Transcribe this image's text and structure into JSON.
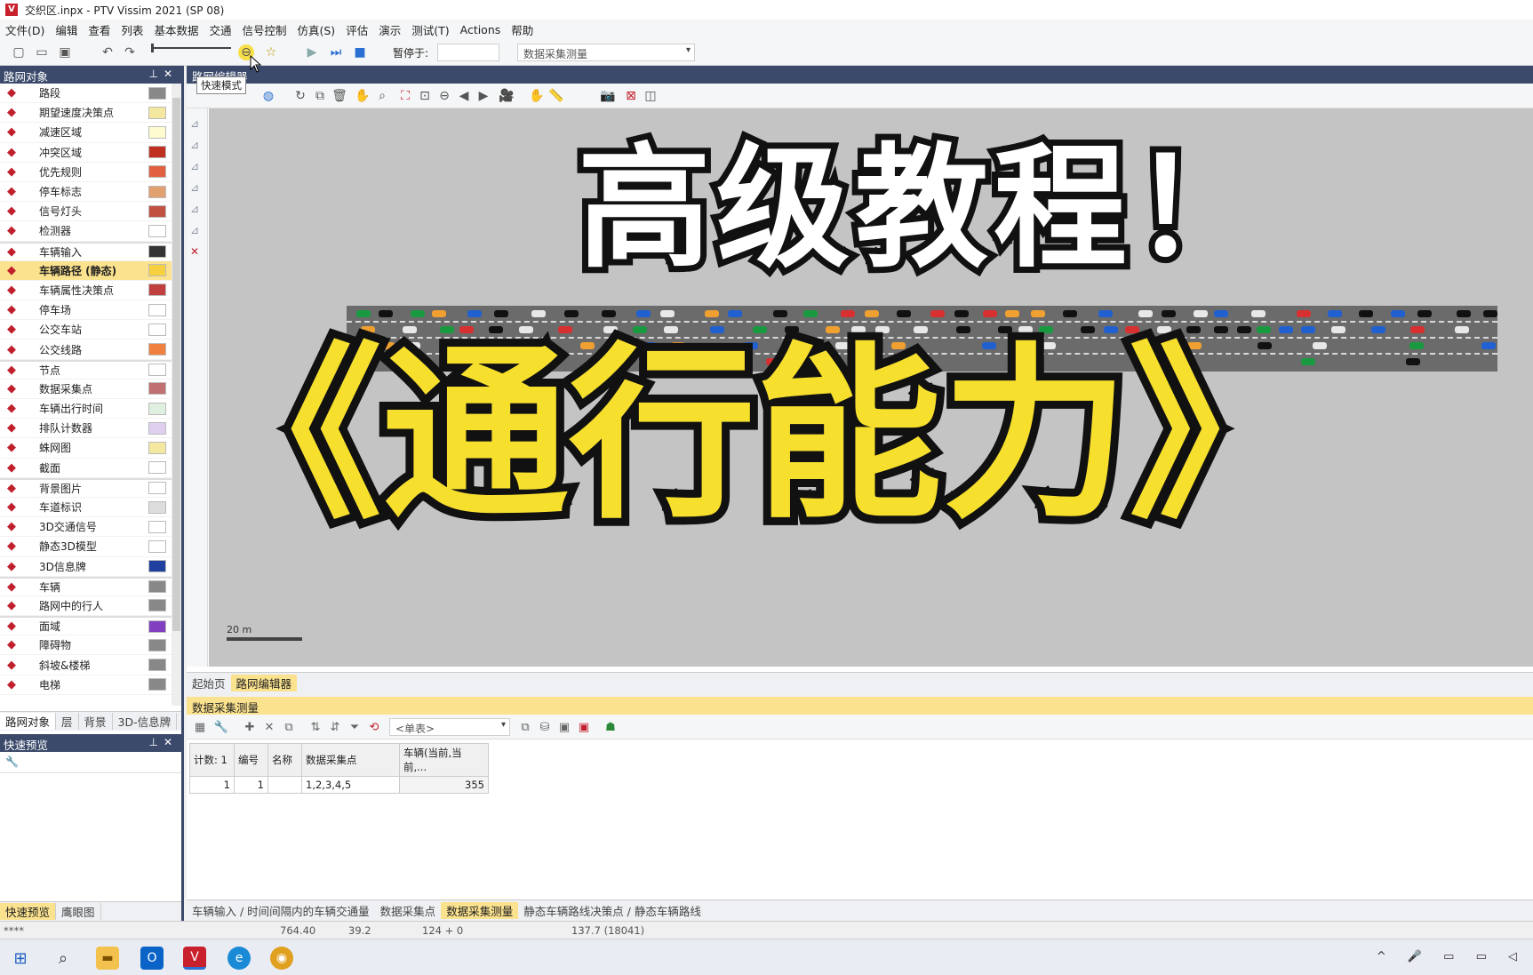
{
  "window": {
    "title": "交织区.inpx - PTV Vissim 2021 (SP 08)",
    "app_icon": "vissim-app-icon"
  },
  "menu": [
    "文件(D)",
    "编辑",
    "查看",
    "列表",
    "基本数据",
    "交通",
    "信号控制",
    "仿真(S)",
    "评估",
    "演示",
    "测试(T)",
    "Actions",
    "帮助"
  ],
  "toolbar": {
    "pause_label": "暂停于:",
    "pause_value": "",
    "view_select": "数据采集测量",
    "tooltip": "快速模式"
  },
  "network_objects": {
    "title": "路网对象",
    "items": [
      {
        "label": "路段",
        "icon": "link-icon",
        "swatch": "#888888"
      },
      {
        "label": "期望速度决策点",
        "icon": "speed-50-icon",
        "swatch": "#f4e7a0"
      },
      {
        "label": "减速区域",
        "icon": "warning-triangle-icon",
        "swatch": "#fffbd0"
      },
      {
        "label": "冲突区域",
        "icon": "conflict-area-icon",
        "swatch": "#c03020"
      },
      {
        "label": "优先规则",
        "icon": "yield-icon",
        "swatch": "#e06040"
      },
      {
        "label": "停车标志",
        "icon": "stop-sign-icon",
        "swatch": "#e0a070"
      },
      {
        "label": "信号灯头",
        "icon": "signal-head-icon",
        "swatch": "#c05040"
      },
      {
        "label": "检测器",
        "icon": "detector-icon",
        "swatch": "#ffffff"
      },
      {
        "label": "车辆输入",
        "icon": "vehicle-input-icon",
        "swatch": "#333333"
      },
      {
        "label": "车辆路径 (静态)",
        "icon": "static-route-icon",
        "swatch": "#f7d040",
        "selected": true
      },
      {
        "label": "车辆属性决策点",
        "icon": "vehicle-attr-icon",
        "swatch": "#c04040"
      },
      {
        "label": "停车场",
        "icon": "parking-icon",
        "swatch": "#ffffff"
      },
      {
        "label": "公交车站",
        "icon": "bus-stop-icon",
        "swatch": "#ffffff"
      },
      {
        "label": "公交线路",
        "icon": "bus-line-icon",
        "swatch": "#f08040"
      },
      {
        "label": "节点",
        "icon": "node-icon",
        "swatch": "#ffffff"
      },
      {
        "label": "数据采集点",
        "icon": "data-point-icon",
        "swatch": "#c07070"
      },
      {
        "label": "车辆出行时间",
        "icon": "travel-time-icon",
        "swatch": "#e0f0e0"
      },
      {
        "label": "排队计数器",
        "icon": "queue-counter-icon",
        "swatch": "#e0d0f0"
      },
      {
        "label": "蛛网图",
        "icon": "spider-icon",
        "swatch": "#f4e7a0"
      },
      {
        "label": "截面",
        "icon": "section-icon",
        "swatch": "#ffffff"
      },
      {
        "label": "背景图片",
        "icon": "background-image-icon",
        "swatch": "#ffffff"
      },
      {
        "label": "车道标识",
        "icon": "lane-marking-icon",
        "swatch": "#dddddd"
      },
      {
        "label": "3D交通信号",
        "icon": "3d-signal-icon",
        "swatch": "#ffffff"
      },
      {
        "label": "静态3D模型",
        "icon": "static-3d-icon",
        "swatch": "#ffffff"
      },
      {
        "label": "3D信息牌",
        "icon": "info-sign-icon",
        "swatch": "#2040a0"
      },
      {
        "label": "车辆",
        "icon": "vehicle-icon",
        "swatch": "#888888"
      },
      {
        "label": "路网中的行人",
        "icon": "pedestrian-icon",
        "swatch": "#888888"
      },
      {
        "label": "面域",
        "icon": "area-icon",
        "swatch": "#8040c0"
      },
      {
        "label": "障碍物",
        "icon": "obstacle-icon",
        "swatch": "#888888"
      },
      {
        "label": "斜坡&楼梯",
        "icon": "ramp-icon",
        "swatch": "#888888"
      },
      {
        "label": "电梯",
        "icon": "elevator-icon",
        "swatch": "#888888"
      }
    ],
    "tabs": [
      "路网对象",
      "层",
      "背景",
      "3D-信息牌"
    ]
  },
  "quick_view": {
    "title": "快速预览",
    "tabs": [
      "快速预览",
      "鹰眼图"
    ]
  },
  "editor": {
    "title": "路网编辑器",
    "scale_label": "20 m",
    "tabs": [
      "起始页",
      "路网编辑器"
    ],
    "overlay_line1": "高级教程！",
    "overlay_line2": "《通行能力》"
  },
  "data_panel": {
    "title": "数据采集测量",
    "filter_value": "<单表>",
    "columns": [
      "计数: 1",
      "编号",
      "名称",
      "数据采集点",
      "车辆(当前,当前,..."
    ],
    "rows": [
      [
        "1",
        "1",
        "",
        "1,2,3,4,5",
        "355"
      ]
    ],
    "tabs": [
      "车辆输入 / 时间间隔内的车辆交通量",
      "数据采集点",
      "数据采集测量",
      "静态车辆路线决策点 / 静态车辆路线"
    ]
  },
  "status": {
    "stars": "****",
    "x": "764.40",
    "y": "39.2",
    "sel": "124 + 0",
    "time": "137.7 (18041)"
  },
  "colors": {
    "panel_header": "#3b4a6b",
    "highlight": "#fbe28e",
    "title_yellow": "#f7df2e"
  }
}
